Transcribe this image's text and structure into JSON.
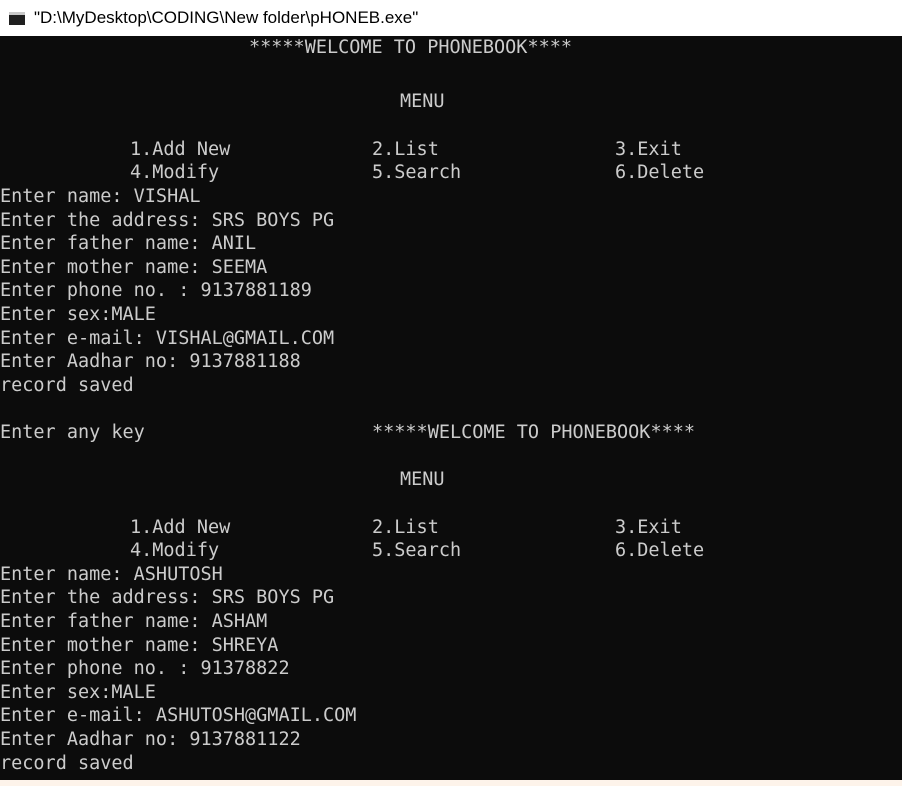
{
  "window": {
    "title": "\"D:\\MyDesktop\\CODING\\New folder\\pHONEB.exe\""
  },
  "console": {
    "banner": "*****WELCOME TO PHONEBOOK****",
    "menu_title": "MENU",
    "menu_items": [
      "1.Add New",
      "2.List",
      "3.Exit",
      "4.Modify",
      "5.Search",
      "6.Delete"
    ],
    "prompt_any_key": "Enter any key",
    "records": [
      {
        "name": "Enter name: VISHAL",
        "address": "Enter the address: SRS BOYS PG",
        "father": "Enter father name: ANIL",
        "mother": "Enter mother name: SEEMA",
        "phone": "Enter phone no. : 9137881189",
        "sex": "Enter sex:MALE",
        "email": "Enter e-mail: VISHAL@GMAIL.COM",
        "aadhar": "Enter Aadhar no: 9137881188",
        "status": "record saved"
      },
      {
        "name": "Enter name: ASHUTOSH",
        "address": "Enter the address: SRS BOYS PG",
        "father": "Enter father name: ASHAM",
        "mother": "Enter mother name: SHREYA",
        "phone": "Enter phone no. : 91378822",
        "sex": "Enter sex:MALE",
        "email": "Enter e-mail: ASHUTOSH@GMAIL.COM",
        "aadhar": "Enter Aadhar no: 9137881122",
        "status": "record saved"
      }
    ]
  },
  "colors": {
    "console_background": "#0c0c0c",
    "console_text": "#cccccc",
    "title_bar_background": "#ffffff",
    "outer_frame": "#fdf3ea"
  },
  "icons": {
    "app_icon": "console-window-icon"
  }
}
